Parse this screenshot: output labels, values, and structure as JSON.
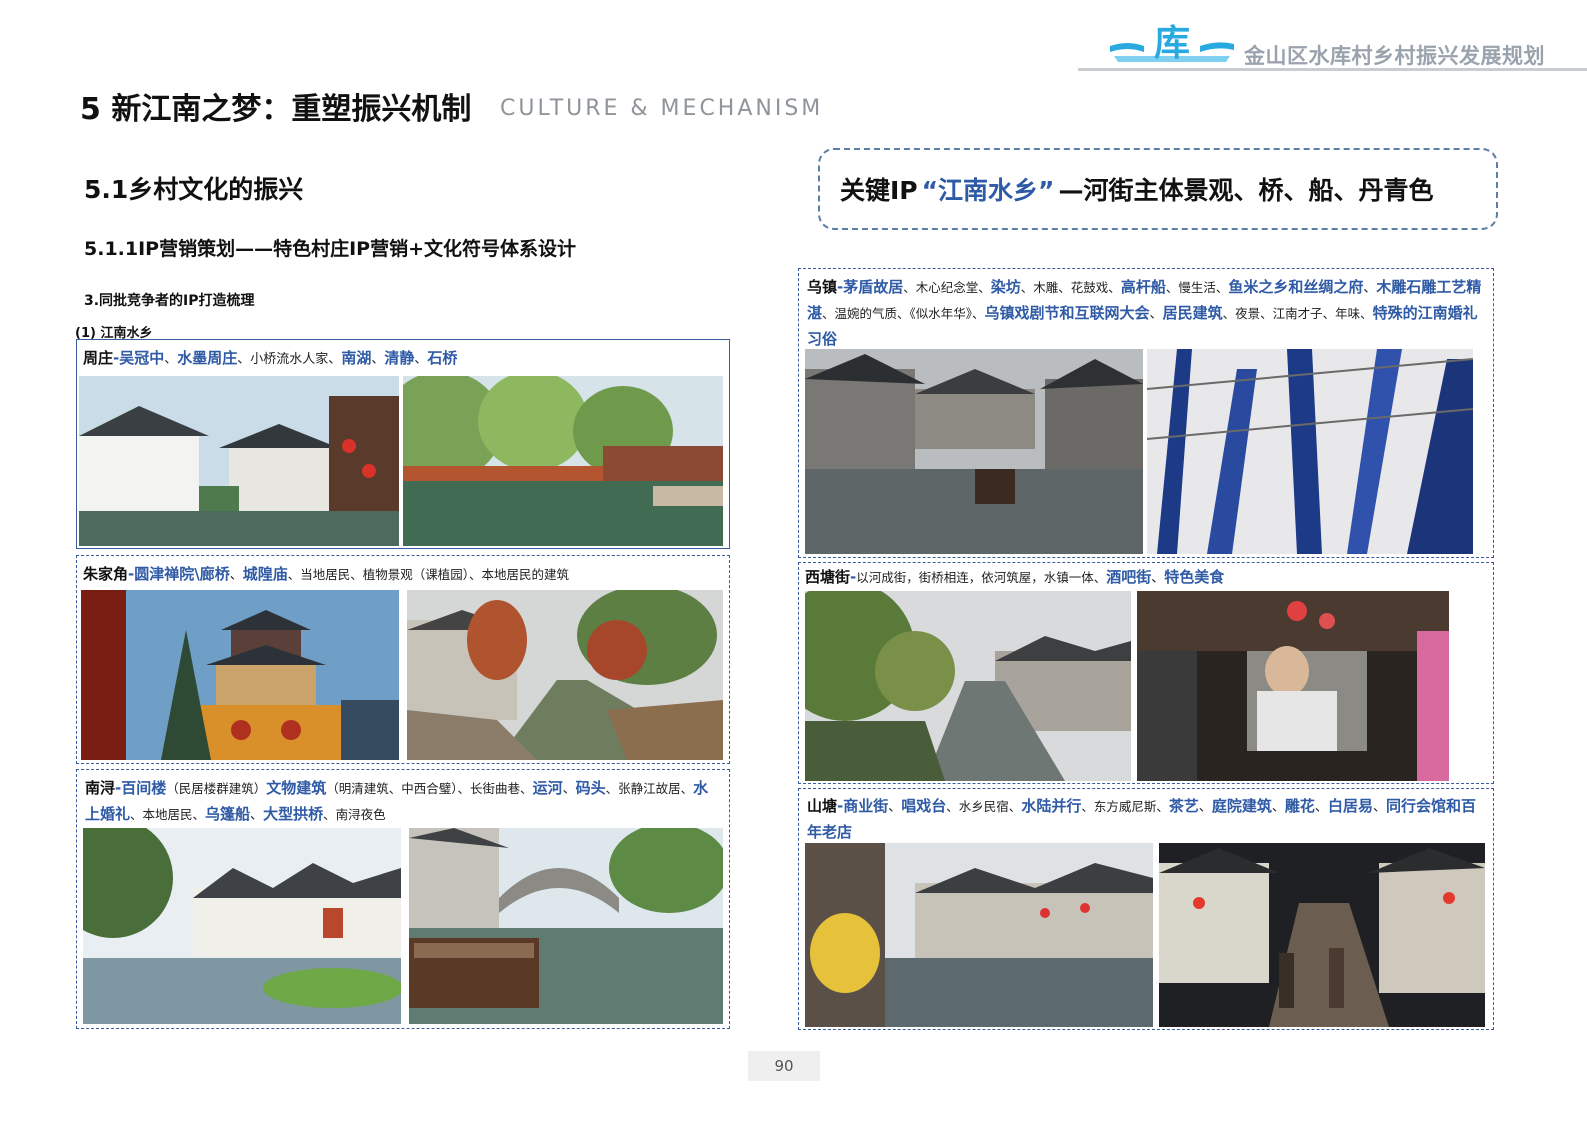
{
  "header": {
    "title": "金山区水库村乡村振兴发展规划",
    "logo_glyph": "库",
    "colors": {
      "logo_blue": "#28a9e0",
      "text_gray": "#9aa3ad"
    }
  },
  "page": {
    "title": "5 新江南之梦：重塑振兴机制",
    "title_en": "CULTURE & MECHANISM",
    "section": "5.1乡村文化的振兴",
    "subsection": "5.1.1IP营销策划——特色村庄IP营销+文化符号体系设计",
    "item": "3.同批竞争者的IP打造梳理",
    "subitem": "(1) 江南水乡",
    "page_number": "90"
  },
  "key_ip": {
    "label": "关键IP",
    "highlight": "“江南水乡”",
    "rest": "—河街主体景观、桥、船、丹青色"
  },
  "cases": {
    "zhouzhuang": {
      "name": "周庄",
      "sep": "-",
      "t1": "吴冠中",
      "s1": "、",
      "t2": "水墨周庄",
      "s2": "、小桥流水人家、",
      "t3": "南湖",
      "s3": "、",
      "t4": "清静",
      "s4": "、",
      "t5": "石桥",
      "photo1": "zhouzhuang-white-houses-canal",
      "photo2": "zhouzhuang-willow-canal"
    },
    "zhujiajiao": {
      "name": "朱家角",
      "sep": "-",
      "t1": "圆津禅院\\廊桥",
      "s1": "、",
      "t2": "城隍庙",
      "s2": "、当地居民、植物景观（课植园）、本地居民的建筑",
      "photo1": "zhujiajiao-pagoda-temple",
      "photo2": "zhujiajiao-canal-street"
    },
    "nanxun": {
      "name": "南浔",
      "sep": "-",
      "t1": "百间楼",
      "s1": "（民居楼群建筑）",
      "t2": "文物建筑",
      "s2": "（明清建筑、中西合璧）、长街曲巷、",
      "t3": "运河",
      "s3": "、",
      "t4": "码头",
      "s4": "、张静江故居、",
      "t5": "水上婚礼",
      "s5": "、本地居民、",
      "t6": "乌篷船",
      "s6": "、",
      "t7": "大型拱桥",
      "s7": "、南浔夜色",
      "photo1": "nanxun-waterside-houses",
      "photo2": "nanxun-arch-bridge-boat"
    },
    "wuzhen": {
      "name": "乌镇",
      "sep": "-",
      "t1": "茅盾故居",
      "s1": "、木心纪念堂、",
      "t2": "染坊",
      "s2": "、木雕、花鼓戏、",
      "t3": "高杆船",
      "s3": "、慢生活、",
      "t4": "鱼米之乡和丝绸之府",
      "s4": "、",
      "t5": "木雕石雕工艺精湛",
      "s5": "、温婉的气质、《似水年华》、",
      "t6": "乌镇戏剧节和互联网大会",
      "s6": "、",
      "t7": "居民建筑",
      "s7": "、夜景、江南才子、年味、",
      "t8": "特殊的江南婚礼习俗",
      "photo1": "wuzhen-canal-boat",
      "photo2": "wuzhen-indigo-dye-cloth"
    },
    "xitang": {
      "name": "西塘街",
      "sep": "-",
      "s0": "以河成街，街桥相连，依河筑屋，水镇一体、",
      "t1": "酒吧街",
      "s1": "、",
      "t2": "特色美食",
      "photo1": "xitang-riverside-street",
      "photo2": "xitang-food-vendor-night"
    },
    "shantang": {
      "name": "山塘",
      "sep": "-",
      "t1": "商业街",
      "s1": "、",
      "t2": "唱戏台",
      "s2": "、水乡民宿、",
      "t3": "水陆并行",
      "s3": "、东方威尼斯、",
      "t4": "茶艺",
      "s4": "、",
      "t5": "庭院建筑",
      "s5": "、",
      "t6": "雕花",
      "s6": "、",
      "t7": "白居易",
      "s7": "、",
      "t8": "同行会馆和百年老店",
      "photo1": "shantang-canal-lanterns",
      "photo2": "shantang-night-street"
    }
  }
}
